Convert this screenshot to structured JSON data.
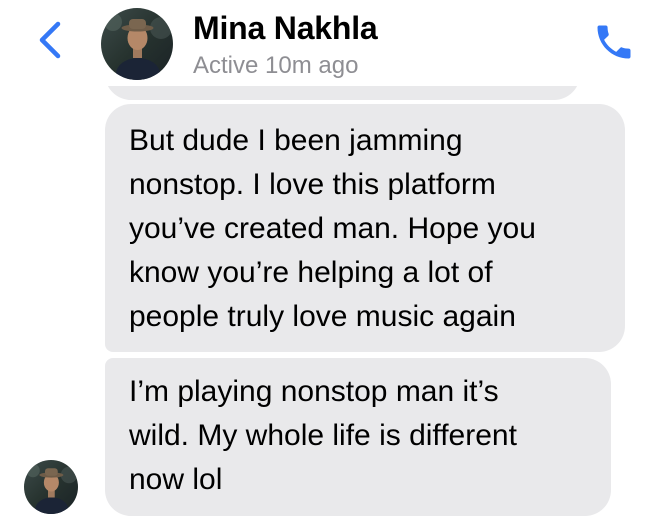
{
  "header": {
    "contact_name": "Mina Nakhla",
    "status": "Active 10m ago",
    "back_icon": "chevron-left-icon",
    "call_icon": "phone-icon",
    "accent_color": "#3478f6"
  },
  "messages": [
    {
      "lines": [
        "But dude I been jamming",
        "nonstop. I love this platform",
        "you’ve created man. Hope you",
        "know you’re helping a lot of",
        "people truly love music again"
      ]
    },
    {
      "lines": [
        "I’m playing nonstop man it’s",
        "wild. My whole life is different",
        "now lol"
      ]
    }
  ],
  "colors": {
    "bubble_incoming": "#e9e9eb",
    "status_text": "#8e8e93"
  }
}
